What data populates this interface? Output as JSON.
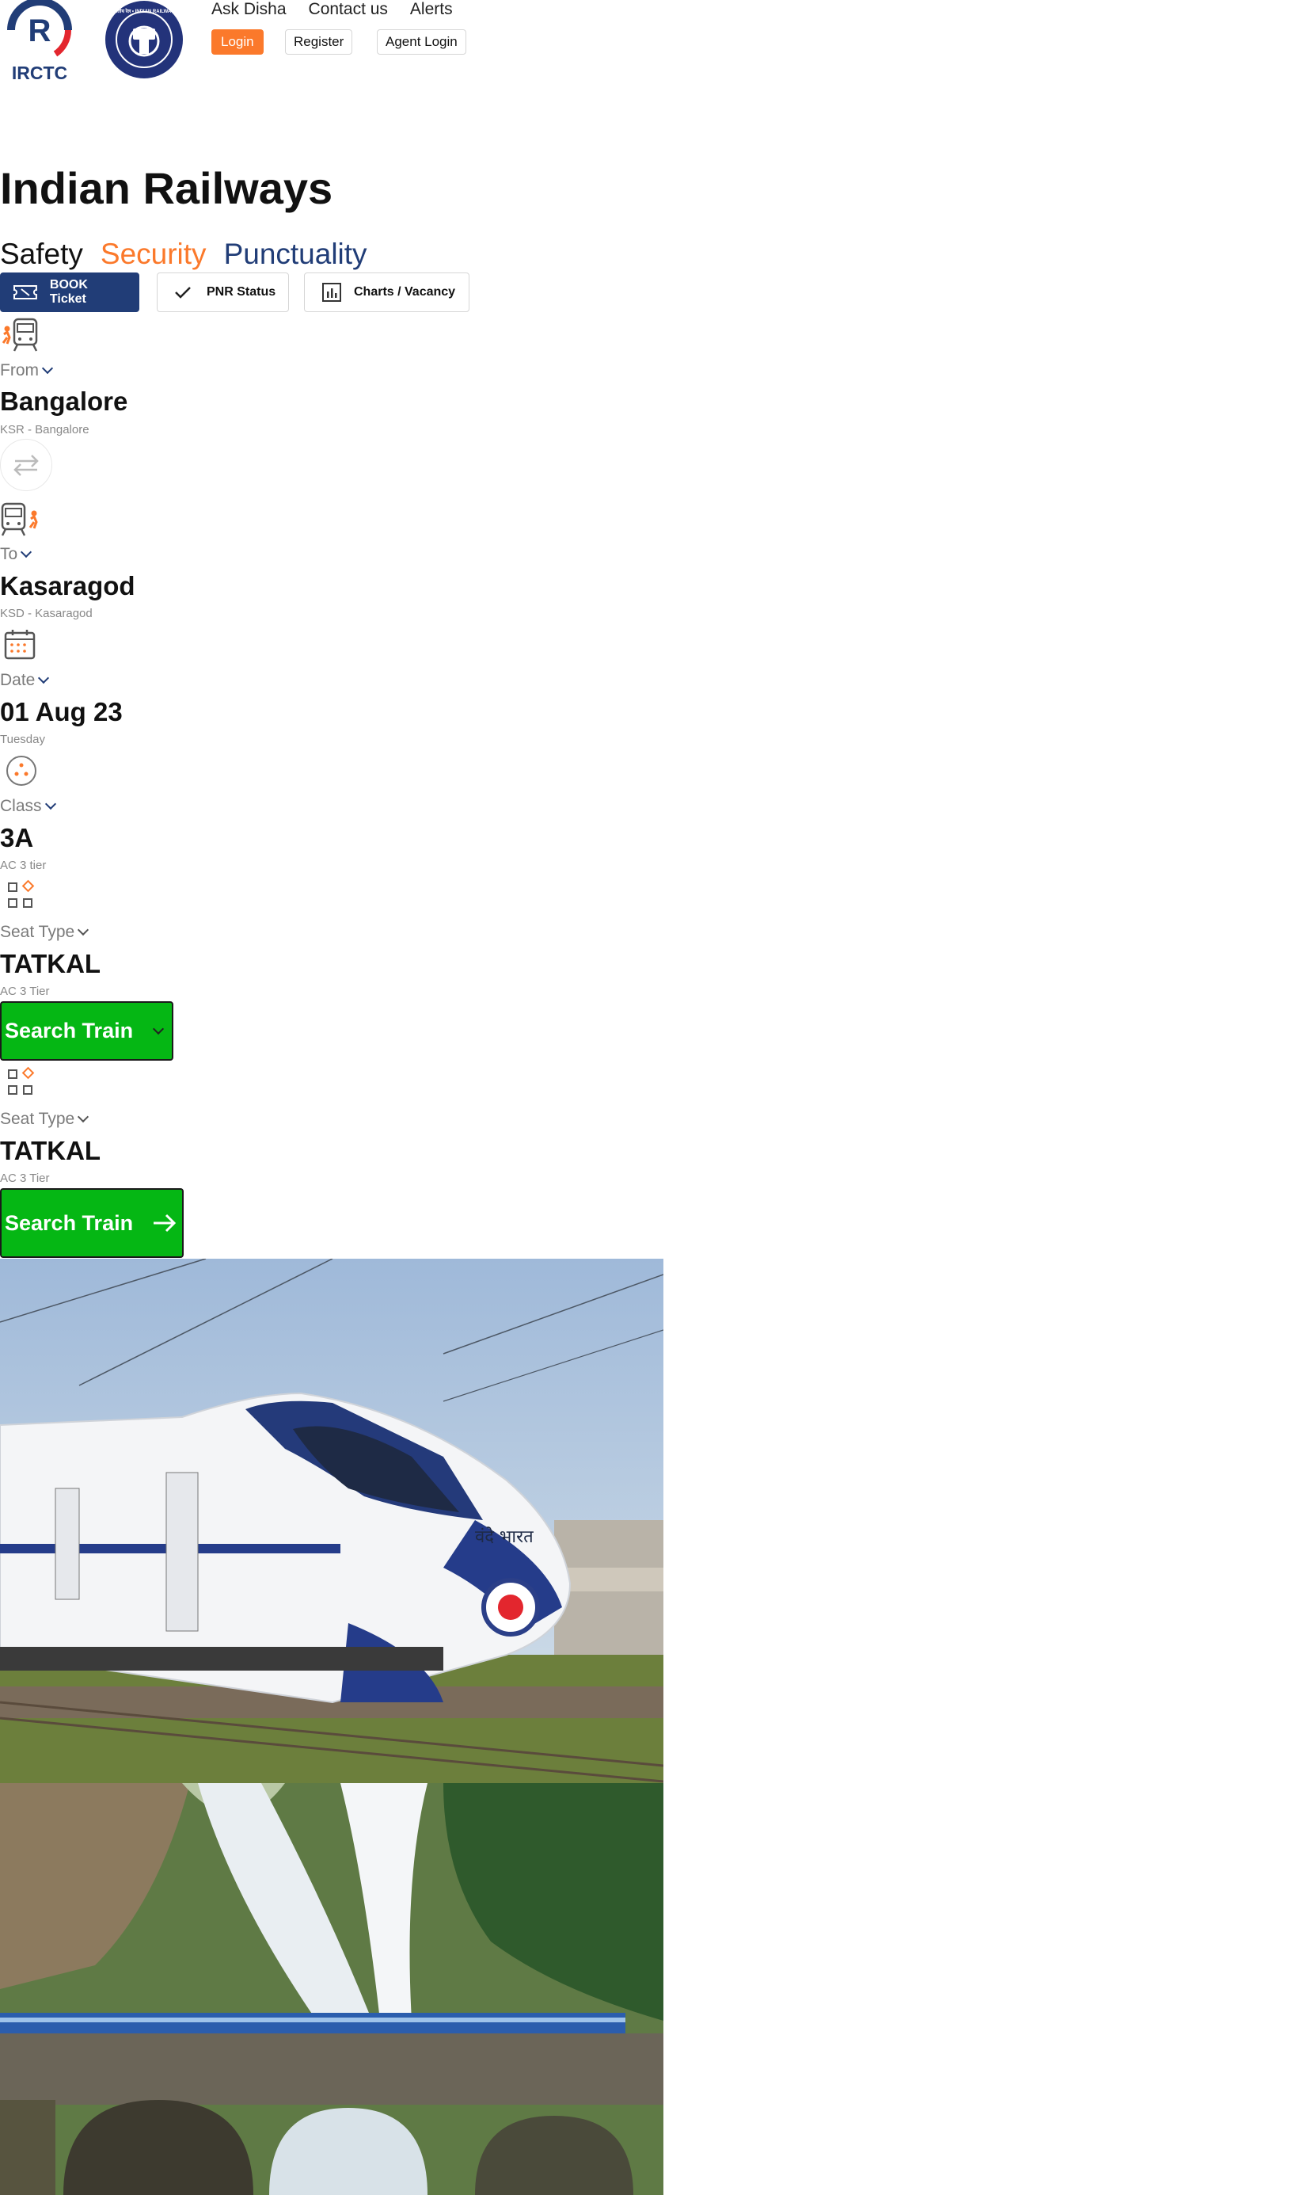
{
  "header": {
    "irctc_logo_text": "IRCTC",
    "rail_logo_text": "भारतीय रेल • INDIAN RAILWAYS",
    "nav": [
      "Ask Disha",
      "Contact us",
      "Alerts"
    ],
    "login": "Login",
    "register": "Register",
    "agent_login": "Agent Login"
  },
  "hero": {
    "title": "Indian Railways",
    "tag_safety": "Safety",
    "tag_security": "Security",
    "tag_punctuality": "Punctuality"
  },
  "tabs": {
    "book": "BOOK Ticket",
    "pnr": "PNR Status",
    "charts": "Charts / Vacancy"
  },
  "form": {
    "from": {
      "label": "From",
      "value": "Bangalore",
      "sub": "KSR - Bangalore"
    },
    "to": {
      "label": "To",
      "value": "Kasaragod",
      "sub": "KSD - Kasaragod"
    },
    "date": {
      "label": "Date",
      "value": "01 Aug 23",
      "sub": "Tuesday"
    },
    "class": {
      "label": "Class",
      "value": "3A",
      "sub": "AC 3 tier"
    },
    "seat1": {
      "label": "Seat Type",
      "value": "TATKAL",
      "sub": "AC 3 Tier"
    },
    "search1": "Search Train",
    "seat2": {
      "label": "Seat Type",
      "value": "TATKAL",
      "sub": "AC 3 Tier"
    },
    "search2": "Search Train"
  },
  "images": {
    "train_text": "वंदे भारत"
  },
  "colors": {
    "brand_blue": "#213d77",
    "brand_orange": "#fb792b",
    "search_green": "#05b714"
  }
}
